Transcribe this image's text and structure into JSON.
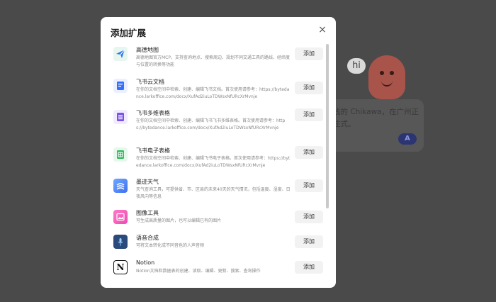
{
  "background": {
    "bubble_text": "hi",
    "card_text": "线的 Chikawa，在广州正住式。",
    "send_label": "A"
  },
  "modal": {
    "title": "添加扩展",
    "close_label": "×",
    "add_label": "添加",
    "items": [
      {
        "name": "高德地图",
        "icon": "amap-icon",
        "color": "#2a78f0",
        "desc": "高德地图官方MCP，支持查询地点、搜索周边、规划不同交通工具的路线、经纬度与位置的转换等功能"
      },
      {
        "name": "飞书云文档",
        "icon": "lark-doc-icon",
        "color": "#3370ff",
        "desc": "在你的文档空间中检索、创建、编辑飞书文档。首次使用请参考：https://bytedance.larkoffice.com/docx/XufAd2iuLoTDWsxNfURcXrMvnje"
      },
      {
        "name": "飞书多维表格",
        "icon": "lark-bitable-icon",
        "color": "#7b52e6",
        "desc": "在你的文档空间中检索、创建、编辑飞书飞书多维表格。首次使用请参考：https://bytedance.larkoffice.com/docx/XufAd2iuLoTDWsxNfURcXrMvnje"
      },
      {
        "name": "飞书电子表格",
        "icon": "lark-sheet-icon",
        "color": "#2fb85b",
        "desc": "在你的文档空间中检索、创建、编辑飞书电子表格。首次使用请参考：https://bytedance.larkoffice.com/docx/XufAd2iuLoTDWsxNfURcXrMvnje"
      },
      {
        "name": "墨迹天气",
        "icon": "moji-weather-icon",
        "color": "#3d6ff2",
        "desc": "天气查询工具，可提供省、市、区县的未来40天的天气情况，包括温度、湿度、日夜风向等信息"
      },
      {
        "name": "图像工具",
        "icon": "image-tool-icon",
        "color": "#ee4ab2",
        "desc": "可生成高质量的图片，也可以编辑已有的图片"
      },
      {
        "name": "语音合成",
        "icon": "tts-icon",
        "color": "#2a4a7c",
        "desc": "可将文本转化成不同音色的人声音频"
      },
      {
        "name": "Notion",
        "icon": "notion-icon",
        "color": "#111111",
        "desc": "Notion文档和数据表的创建、读取、编辑、更新、搜索、查询操作"
      }
    ]
  }
}
